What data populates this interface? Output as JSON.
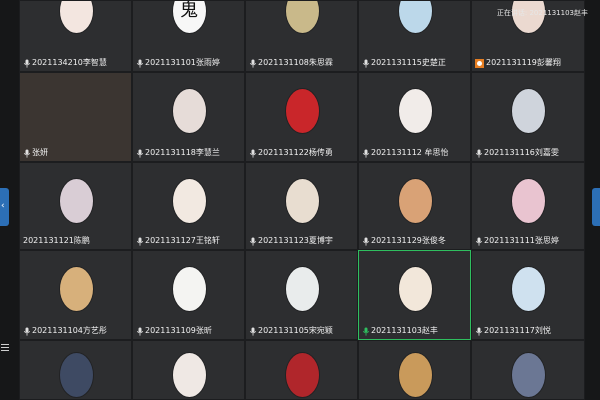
{
  "speaking_indicator": "正在讲话: 2021131103赵丰",
  "participants": [
    {
      "label": "2021134210李智慧",
      "mic": "mic-icon",
      "avatar_color": "#f3e6e0",
      "avatar_glyph": ""
    },
    {
      "label": "2021131101张雨婷",
      "mic": "mic-icon",
      "avatar_color": "#f7f7f7",
      "avatar_glyph": "鬼"
    },
    {
      "label": "2021131108朱思霖",
      "mic": "mic-icon",
      "avatar_color": "#c9b98a",
      "avatar_glyph": ""
    },
    {
      "label": "2021131115史楚正",
      "mic": "mic-icon",
      "avatar_color": "#bcd8ea",
      "avatar_glyph": ""
    },
    {
      "label": "2021131119彭馨翔",
      "mic": "host-badge-icon",
      "avatar_color": "#ebd9d0",
      "avatar_glyph": ""
    },
    {
      "label": "张妍",
      "mic": "mic-icon",
      "avatar_color": "",
      "avatar_glyph": "",
      "photo": "#3b3531"
    },
    {
      "label": "2021131118李慧兰",
      "mic": "mic-icon",
      "avatar_color": "#e6dcd8",
      "avatar_glyph": ""
    },
    {
      "label": "2021131122杨传勇",
      "mic": "mic-icon",
      "avatar_color": "#c9262a",
      "avatar_glyph": ""
    },
    {
      "label": "2021131112 牟思怡",
      "mic": "mic-icon",
      "avatar_color": "#f1ece9",
      "avatar_glyph": ""
    },
    {
      "label": "2021131116刘嘉雯",
      "mic": "mic-icon",
      "avatar_color": "#cfd4dc",
      "avatar_glyph": ""
    },
    {
      "label": "2021131121陈鹏",
      "mic": "",
      "avatar_color": "#d9cdd5",
      "avatar_glyph": ""
    },
    {
      "label": "2021131127王铭轩",
      "mic": "mic-icon",
      "avatar_color": "#f2e9e1",
      "avatar_glyph": ""
    },
    {
      "label": "2021131123夏博宇",
      "mic": "mic-icon",
      "avatar_color": "#e8ddd0",
      "avatar_glyph": ""
    },
    {
      "label": "2021131129张俊冬",
      "mic": "mic-icon",
      "avatar_color": "#d9a276",
      "avatar_glyph": ""
    },
    {
      "label": "2021131111张思婷",
      "mic": "mic-icon",
      "avatar_color": "#e9c4d0",
      "avatar_glyph": ""
    },
    {
      "label": "2021131104方艺彤",
      "mic": "mic-icon",
      "avatar_color": "#d7b07b",
      "avatar_glyph": ""
    },
    {
      "label": "2021131109张昕",
      "mic": "mic-icon",
      "avatar_color": "#f4f4f2",
      "avatar_glyph": ""
    },
    {
      "label": "2021131105宋宛颖",
      "mic": "mic-icon",
      "avatar_color": "#e9ecec",
      "avatar_glyph": ""
    },
    {
      "label": "2021131103赵丰",
      "mic": "mic-active-icon",
      "avatar_color": "#f2e7da",
      "avatar_glyph": "",
      "active": true
    },
    {
      "label": "2021131117刘悦",
      "mic": "mic-icon",
      "avatar_color": "#cfe1ef",
      "avatar_glyph": ""
    },
    {
      "label": "",
      "mic": "",
      "avatar_color": "#3e4a63",
      "avatar_glyph": ""
    },
    {
      "label": "",
      "mic": "",
      "avatar_color": "#efe8e4",
      "avatar_glyph": ""
    },
    {
      "label": "",
      "mic": "",
      "avatar_color": "#b0262b",
      "avatar_glyph": ""
    },
    {
      "label": "",
      "mic": "",
      "avatar_color": "#c99a5b",
      "avatar_glyph": ""
    },
    {
      "label": "",
      "mic": "",
      "avatar_color": "#6b7794",
      "avatar_glyph": ""
    }
  ],
  "icons": {
    "left_tab": "chevron-left-icon",
    "menu": "menu-icon"
  },
  "left_tab_glyph": "‹"
}
